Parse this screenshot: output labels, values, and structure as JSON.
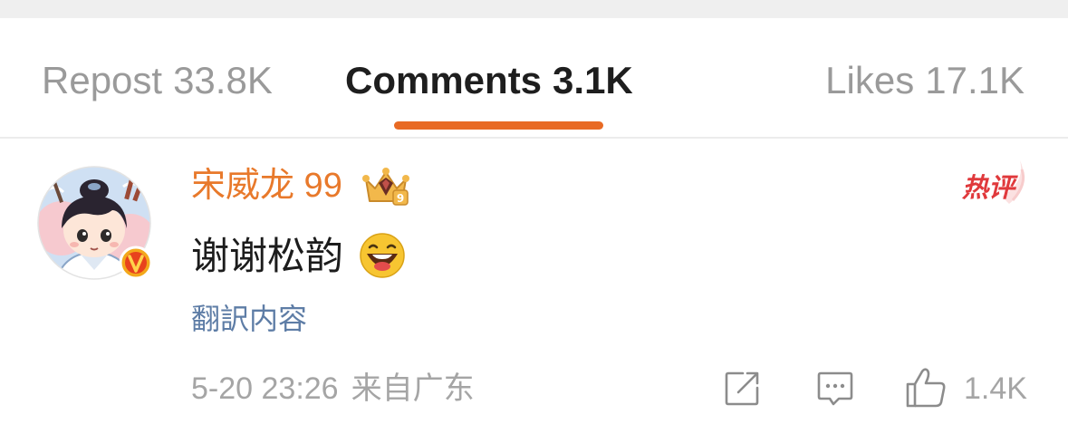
{
  "tabs": [
    {
      "label": "Repost",
      "count": "33.8K",
      "active": false
    },
    {
      "label": "Comments",
      "count": "3.1K",
      "active": true
    },
    {
      "label": "Likes",
      "count": "17.1K",
      "active": false
    }
  ],
  "colors": {
    "accent": "#e86a24",
    "username": "#e8792b",
    "link": "#5e7da6",
    "muted": "#a5a5a5",
    "hot_badge": "#e0393c",
    "verified_badge": "#f3a81b"
  },
  "comment": {
    "avatar_icon": "cartoon-avatar",
    "verified_badge_icon": "verified-v-badge",
    "username": "宋威龙 99",
    "level_icon": "crown-icon",
    "hot_badge": "热评",
    "text": "谢谢松韵",
    "emoji_icon": "laughing-emoji",
    "translate_label": "翻訳内容",
    "timestamp": "5-20 23:26",
    "source": "来自广东",
    "actions": {
      "share_icon": "share-icon",
      "comment_icon": "comment-icon",
      "like_icon": "thumbs-up-icon",
      "like_count": "1.4K"
    }
  }
}
